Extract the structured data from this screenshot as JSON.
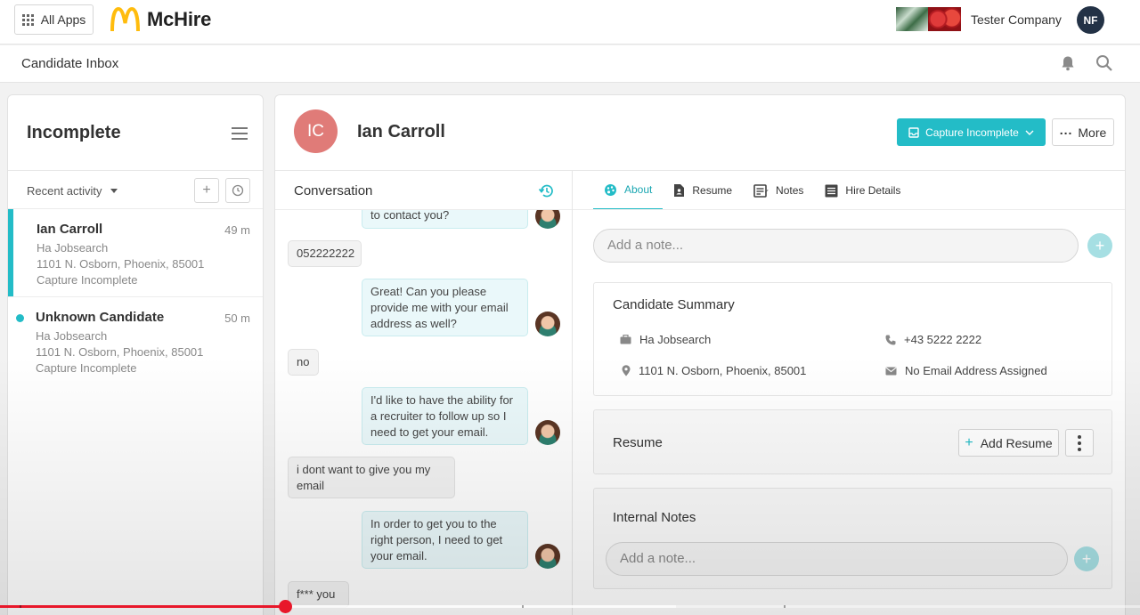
{
  "topbar": {
    "all_apps_label": "All Apps",
    "brand": "McHire",
    "company": "Tester Company",
    "user_initials": "NF"
  },
  "subbar": {
    "title": "Candidate Inbox"
  },
  "left_panel": {
    "title": "Incomplete",
    "sort_label": "Recent activity",
    "candidates": [
      {
        "name": "Ian Carroll",
        "time": "49 m",
        "source": "Ha Jobsearch",
        "address": "1101 N. Osborn, Phoenix, 85001",
        "status": "Capture Incomplete",
        "active": true
      },
      {
        "name": "Unknown Candidate",
        "time": "50 m",
        "source": "Ha Jobsearch",
        "address": "1101 N. Osborn, Phoenix, 85001",
        "status": "Capture Incomplete",
        "unread": true
      }
    ]
  },
  "candidate": {
    "initials": "IC",
    "name": "Ian Carroll",
    "capture_button": "Capture Incomplete",
    "more_button": "More"
  },
  "conversation": {
    "title": "Conversation",
    "messages": [
      {
        "from": "bot",
        "text": "to contact you?"
      },
      {
        "from": "user",
        "text": "052222222"
      },
      {
        "from": "bot",
        "text": "Great! Can you please provide me with your email address as well?"
      },
      {
        "from": "user",
        "text": "no"
      },
      {
        "from": "bot",
        "text": "I'd like to have the ability for a recruiter to follow up so I need to get your email."
      },
      {
        "from": "user",
        "text": "i dont want to give you my email"
      },
      {
        "from": "bot",
        "text": "In order to get you to the right person, I need to get your email."
      },
      {
        "from": "user",
        "text": "f*** you"
      }
    ]
  },
  "tabs": [
    {
      "label": "About",
      "icon": "palette-icon",
      "active": true
    },
    {
      "label": "Resume",
      "icon": "resume-icon"
    },
    {
      "label": "Notes",
      "icon": "notes-icon"
    },
    {
      "label": "Hire Details",
      "icon": "list-icon"
    }
  ],
  "about": {
    "note_placeholder": "Add a note...",
    "summary": {
      "title": "Candidate Summary",
      "source": "Ha Jobsearch",
      "phone": "+43 5222 2222",
      "address": "1101 N. Osborn, Phoenix, 85001",
      "email": "No Email Address Assigned"
    },
    "resume": {
      "title": "Resume",
      "add_button": "Add Resume"
    },
    "internal_notes": {
      "title": "Internal Notes",
      "placeholder": "Add a note..."
    }
  },
  "video": {
    "progress": 0.25
  },
  "colors": {
    "accent": "#23bcc7",
    "avatar_ic": "#e07b78",
    "avatar_nf": "#233246",
    "progress": "#e8172a"
  }
}
